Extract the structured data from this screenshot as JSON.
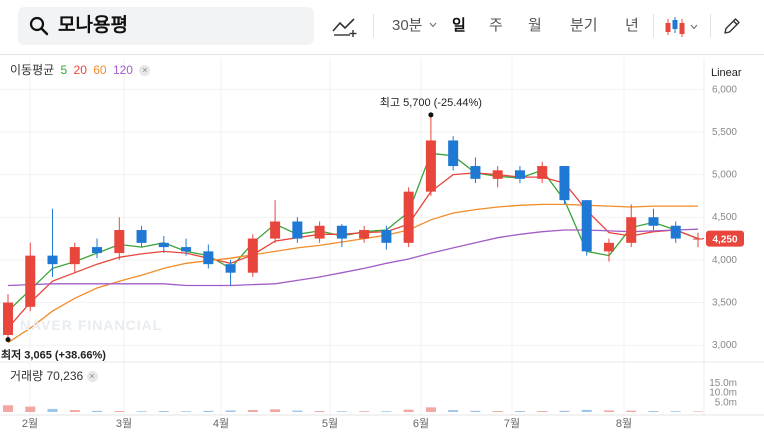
{
  "search": {
    "stock_name": "모나용평",
    "icon": "search-icon"
  },
  "toolbar": {
    "draw_icon": "trend-line-add-icon",
    "interval": "30분",
    "periods": [
      "일",
      "주",
      "월",
      "분기",
      "년"
    ],
    "active_period": "일",
    "chart_type_icon": "candlestick-icon",
    "edit_icon": "pencil-icon"
  },
  "indicators": {
    "title": "이동평균",
    "ma": [
      {
        "label": "5",
        "color": "#3aa33a"
      },
      {
        "label": "20",
        "color": "#e8453c"
      },
      {
        "label": "60",
        "color": "#f28c28"
      },
      {
        "label": "120",
        "color": "#a35cc8"
      }
    ]
  },
  "volume": {
    "label": "거래량",
    "value": "70,236",
    "axis_labels": [
      "15.0m",
      "10.0m",
      "5.0m"
    ]
  },
  "scale_label": "Linear",
  "watermark": "NAVER FINANCIAL",
  "colors": {
    "up": "#e8453c",
    "down": "#1e78d4",
    "price_badge": "#e8453c"
  },
  "chart_data": {
    "type": "candlestick",
    "y_axis": {
      "ticks": [
        "6,000",
        "5,500",
        "5,000",
        "4,500",
        "4,000",
        "3,500",
        "3,000"
      ],
      "range": [
        2850,
        6050
      ]
    },
    "x_axis": {
      "labels": [
        "2월",
        "3월",
        "4월",
        "5월",
        "6월",
        "7월",
        "8월"
      ]
    },
    "current_price": "4,250",
    "annotations": {
      "high_text": "최고 5,700 (-25.44%)",
      "low_text": "최저 3,065 (+38.66%)"
    },
    "series": [
      {
        "name": "5",
        "values": [
          3400,
          3650,
          3900,
          3980,
          4080,
          4180,
          4150,
          4200,
          4100,
          4050,
          3900,
          4200,
          4420,
          4300,
          4340,
          4280,
          4330,
          4350,
          4560,
          5250,
          5220,
          5020,
          4980,
          4960,
          5050,
          4700,
          4100,
          4050,
          4380,
          4440,
          4350,
          4250
        ]
      },
      {
        "name": "20",
        "values": [
          3200,
          3500,
          3750,
          3850,
          3950,
          4030,
          4070,
          4100,
          4080,
          4020,
          3960,
          4060,
          4220,
          4260,
          4300,
          4300,
          4320,
          4330,
          4420,
          4800,
          5000,
          5020,
          5000,
          4970,
          4970,
          4900,
          4580,
          4320,
          4280,
          4330,
          4350,
          4250
        ]
      },
      {
        "name": "60",
        "values": [
          3030,
          3200,
          3400,
          3550,
          3670,
          3750,
          3820,
          3900,
          3960,
          3990,
          4020,
          4060,
          4100,
          4140,
          4170,
          4210,
          4250,
          4290,
          4350,
          4470,
          4550,
          4590,
          4620,
          4640,
          4650,
          4650,
          4640,
          4630,
          4620,
          4630,
          4630,
          4630
        ]
      },
      {
        "name": "120",
        "values": [
          3700,
          3710,
          3720,
          3720,
          3720,
          3720,
          3720,
          3720,
          3700,
          3700,
          3700,
          3710,
          3720,
          3760,
          3800,
          3850,
          3900,
          3960,
          4010,
          4080,
          4140,
          4200,
          4260,
          4300,
          4330,
          4350,
          4350,
          4340,
          4330,
          4340,
          4350,
          4360
        ]
      }
    ],
    "candles": [
      {
        "o": 3120,
        "h": 3600,
        "l": 3065,
        "c": 3500
      },
      {
        "o": 3450,
        "h": 4200,
        "l": 3400,
        "c": 4050
      },
      {
        "o": 4050,
        "h": 4600,
        "l": 3800,
        "c": 3950
      },
      {
        "o": 3950,
        "h": 4200,
        "l": 3850,
        "c": 4150
      },
      {
        "o": 4150,
        "h": 4250,
        "l": 4020,
        "c": 4080
      },
      {
        "o": 4080,
        "h": 4500,
        "l": 4000,
        "c": 4350
      },
      {
        "o": 4350,
        "h": 4400,
        "l": 4150,
        "c": 4200
      },
      {
        "o": 4200,
        "h": 4280,
        "l": 4080,
        "c": 4150
      },
      {
        "o": 4150,
        "h": 4250,
        "l": 4050,
        "c": 4100
      },
      {
        "o": 4100,
        "h": 4180,
        "l": 3900,
        "c": 3950
      },
      {
        "o": 3950,
        "h": 4000,
        "l": 3700,
        "c": 3850
      },
      {
        "o": 3850,
        "h": 4300,
        "l": 3800,
        "c": 4250
      },
      {
        "o": 4250,
        "h": 4700,
        "l": 4200,
        "c": 4450
      },
      {
        "o": 4450,
        "h": 4500,
        "l": 4200,
        "c": 4250
      },
      {
        "o": 4250,
        "h": 4450,
        "l": 4200,
        "c": 4400
      },
      {
        "o": 4400,
        "h": 4420,
        "l": 4150,
        "c": 4250
      },
      {
        "o": 4250,
        "h": 4400,
        "l": 4200,
        "c": 4350
      },
      {
        "o": 4350,
        "h": 4400,
        "l": 4120,
        "c": 4200
      },
      {
        "o": 4200,
        "h": 4850,
        "l": 4150,
        "c": 4800
      },
      {
        "o": 4800,
        "h": 5700,
        "l": 4750,
        "c": 5400
      },
      {
        "o": 5400,
        "h": 5450,
        "l": 5050,
        "c": 5100
      },
      {
        "o": 5100,
        "h": 5200,
        "l": 4900,
        "c": 4950
      },
      {
        "o": 4950,
        "h": 5100,
        "l": 4850,
        "c": 5050
      },
      {
        "o": 5050,
        "h": 5100,
        "l": 4900,
        "c": 4950
      },
      {
        "o": 4950,
        "h": 5150,
        "l": 4900,
        "c": 5100
      },
      {
        "o": 5100,
        "h": 5100,
        "l": 4650,
        "c": 4700
      },
      {
        "o": 4700,
        "h": 4700,
        "l": 4050,
        "c": 4100
      },
      {
        "o": 4100,
        "h": 4250,
        "l": 3980,
        "c": 4200
      },
      {
        "o": 4200,
        "h": 4650,
        "l": 4150,
        "c": 4500
      },
      {
        "o": 4500,
        "h": 4600,
        "l": 4350,
        "c": 4400
      },
      {
        "o": 4400,
        "h": 4450,
        "l": 4200,
        "c": 4250
      },
      {
        "o": 4250,
        "h": 4320,
        "l": 4150,
        "c": 4250
      }
    ],
    "volumes": [
      3.5,
      2.8,
      1.6,
      1.0,
      0.6,
      0.5,
      0.4,
      0.5,
      0.4,
      0.6,
      0.8,
      1.0,
      1.4,
      0.7,
      0.5,
      0.4,
      0.4,
      0.4,
      1.2,
      2.4,
      1.0,
      0.6,
      0.5,
      0.5,
      0.5,
      0.6,
      1.1,
      0.8,
      0.7,
      0.5,
      0.4,
      0.3
    ]
  }
}
